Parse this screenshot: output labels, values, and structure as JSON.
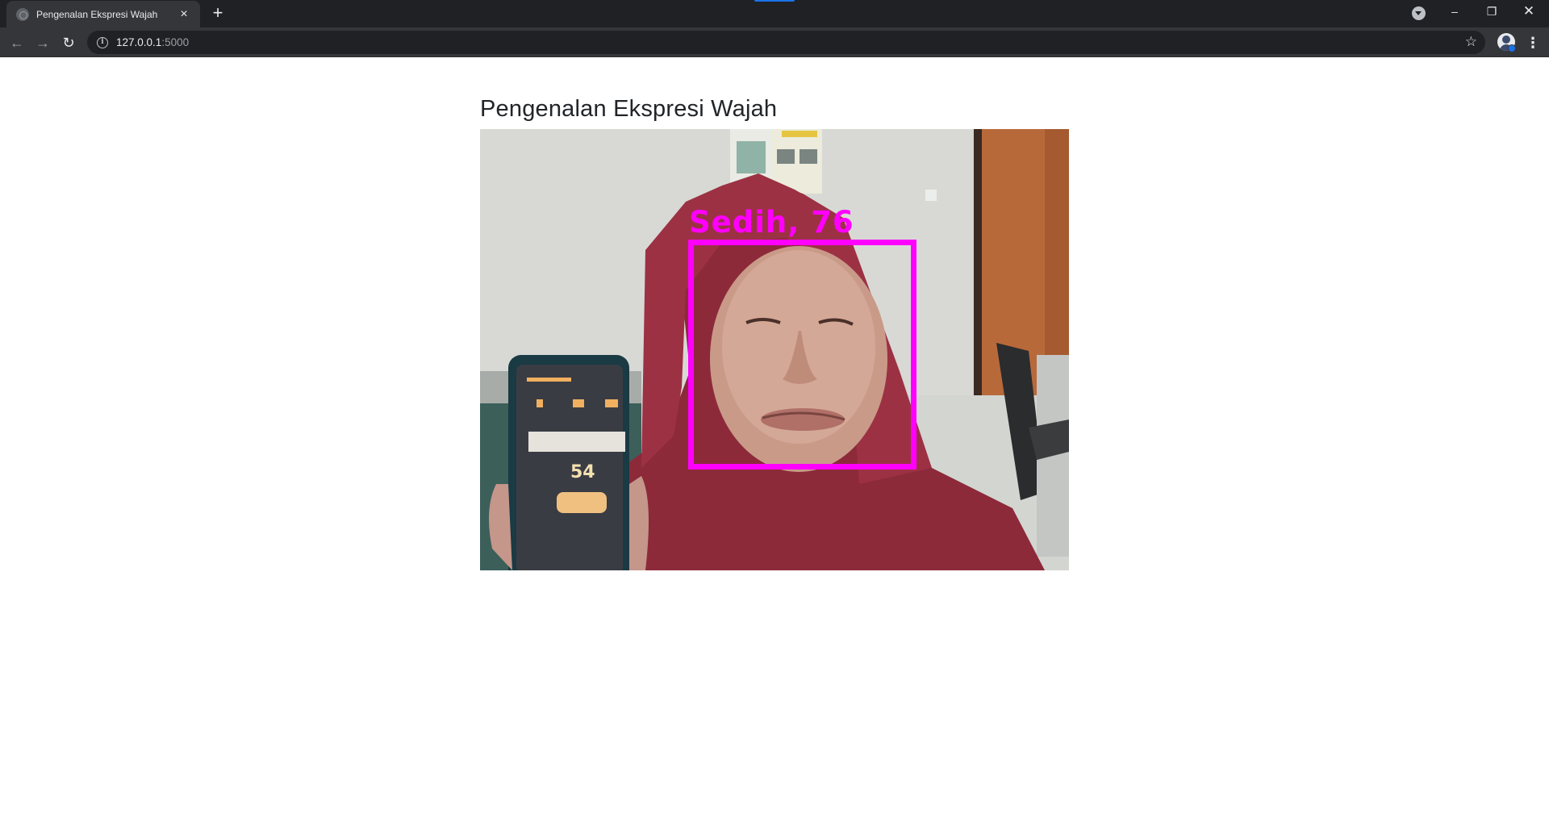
{
  "browser": {
    "tab": {
      "title": "Pengenalan Ekspresi Wajah",
      "favicon": "globe-icon",
      "close_icon": "×"
    },
    "new_tab_icon": "+",
    "window_controls": {
      "minimize": "–",
      "maximize": "❐",
      "close": "✕"
    },
    "nav": {
      "back": "←",
      "forward": "→",
      "reload": "↻"
    },
    "address_bar": {
      "host": "127.0.0.1",
      "port": ":5000",
      "security_icon": "info-icon"
    },
    "bookmark_icon": "☆",
    "menu_icon": "⋮"
  },
  "page": {
    "title": "Pengenalan Ekspresi Wajah",
    "video": {
      "detection_label": "Sedih, 76",
      "detection_color": "#ff00ff"
    }
  },
  "colors": {
    "chrome_dark": "#202124",
    "chrome_toolbar": "#35363a",
    "accent": "#1a73e8",
    "detection": "#ff00ff"
  }
}
